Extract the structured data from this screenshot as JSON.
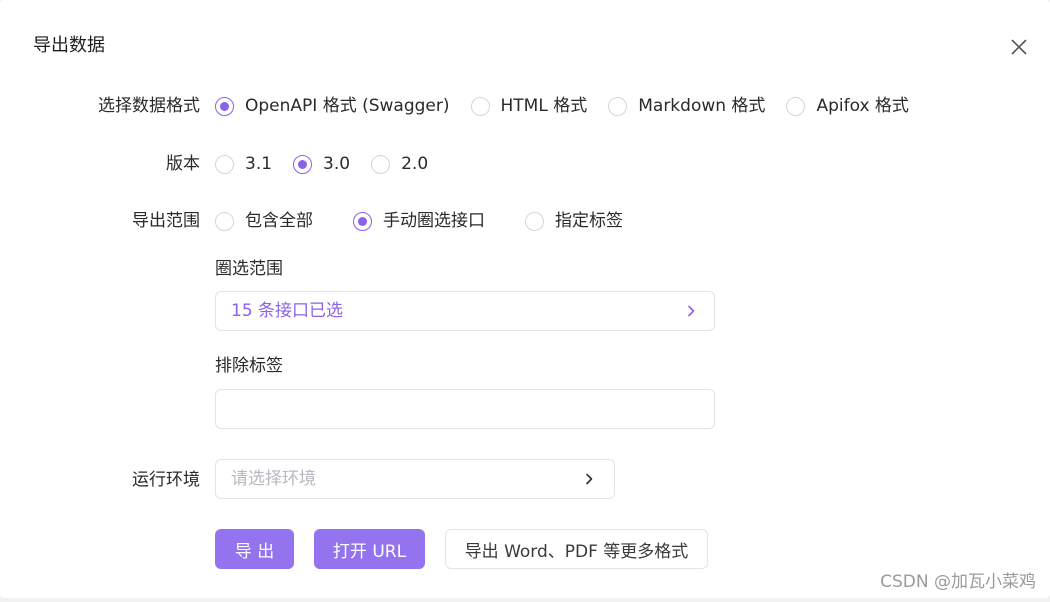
{
  "dialog": {
    "title": "导出数据",
    "close_icon": "close-icon"
  },
  "format": {
    "label": "选择数据格式",
    "options": [
      "OpenAPI 格式 (Swagger)",
      "HTML 格式",
      "Markdown 格式",
      "Apifox 格式"
    ],
    "selected": "OpenAPI 格式 (Swagger)"
  },
  "version": {
    "label": "版本",
    "options": [
      "3.1",
      "3.0",
      "2.0"
    ],
    "selected": "3.0"
  },
  "scope": {
    "label": "导出范围",
    "options": [
      "包含全部",
      "手动圈选接口",
      "指定标签"
    ],
    "selected": "手动圈选接口"
  },
  "selection": {
    "label": "圈选范围",
    "value": "15 条接口已选",
    "chevron_icon": "chevron-right-icon"
  },
  "exclude_tags": {
    "label": "排除标签",
    "value": ""
  },
  "environment": {
    "label": "运行环境",
    "placeholder": "请选择环境",
    "chevron_icon": "chevron-right-icon"
  },
  "actions": {
    "export": "导 出",
    "open_url": "打开 URL",
    "more_formats": "导出 Word、PDF 等更多格式"
  },
  "watermark": "CSDN @加瓦小菜鸡",
  "colors": {
    "accent": "#9373ee",
    "radio_checked": "#8a63e8",
    "link_text": "#8a63e8",
    "placeholder": "#b8b8c0"
  }
}
